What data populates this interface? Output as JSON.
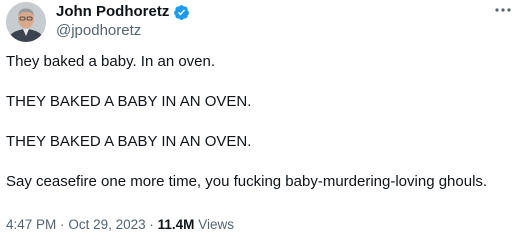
{
  "author": {
    "display_name": "John Podhoretz",
    "handle": "@jpodhoretz",
    "verified_color": "#1d9bf0",
    "avatar_icon": "profile-photo"
  },
  "more_icon": "more-horizontal-icon",
  "tweet": {
    "paragraphs": [
      "They baked a baby. In an oven.",
      "THEY BAKED A BABY IN AN OVEN.",
      "THEY BAKED A BABY IN AN OVEN.",
      "Say ceasefire one more time, you fucking baby-murdering-loving ghouls."
    ]
  },
  "meta": {
    "time": "4:47 PM",
    "separator": "·",
    "date": "Oct 29, 2023",
    "views_count": "11.4M",
    "views_label": "Views"
  },
  "colors": {
    "text": "#0f1419",
    "secondary": "#536471",
    "background": "#ffffff"
  }
}
